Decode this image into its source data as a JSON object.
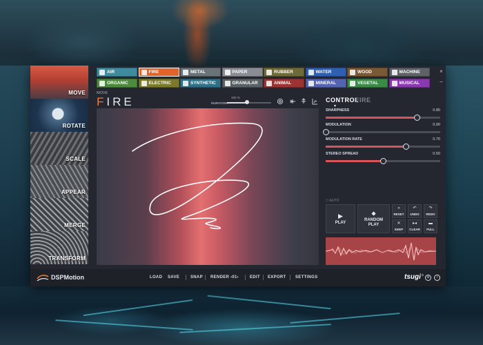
{
  "sidebar": {
    "items": [
      {
        "label": "MOVE"
      },
      {
        "label": "ROTATE"
      },
      {
        "label": "SCALE"
      },
      {
        "label": "APPEAR"
      },
      {
        "label": "MERGE"
      },
      {
        "label": "TRANSFORM"
      }
    ],
    "active": "MOVE"
  },
  "categories": [
    {
      "label": "AIR",
      "color": "#3f8a9c"
    },
    {
      "label": "FIRE",
      "color": "#e0642a",
      "active": true
    },
    {
      "label": "METAL",
      "color": "#6a7478"
    },
    {
      "label": "PAPER",
      "color": "#8a8e94"
    },
    {
      "label": "RUBBER",
      "color": "#6f6a3a"
    },
    {
      "label": "WATER",
      "color": "#2f5fb0"
    },
    {
      "label": "WOOD",
      "color": "#7a5a36"
    },
    {
      "label": "MACHINE",
      "color": "#5e6266"
    },
    {
      "label": "ORGANIC",
      "color": "#4c8a3e"
    },
    {
      "label": "ELECTRIC",
      "color": "#7a7a2a"
    },
    {
      "label": "SYNTHETIC",
      "color": "#2f6f86"
    },
    {
      "label": "GRANULAR",
      "color": "#5a6166"
    },
    {
      "label": "ANIMAL",
      "color": "#9c3434"
    },
    {
      "label": "MINERAL",
      "color": "#5563b0"
    },
    {
      "label": "VEGETAL",
      "color": "#3b8a48"
    },
    {
      "label": "MUSICAL",
      "color": "#8a3ab0"
    }
  ],
  "window": {
    "close_icon": "×",
    "minimize_icon": "–"
  },
  "preset": {
    "category": "MOVE",
    "name_initial": "F",
    "name_rest": "IRE",
    "duration_label": "DURATION",
    "duration_value": "100 %",
    "duration_fraction": 0.45
  },
  "tools": [
    "target-icon",
    "split-icon",
    "arrows-icon",
    "chart-icon"
  ],
  "control": {
    "tab_control": "CONTROL",
    "tab_fire": "FIRE",
    "params": [
      {
        "label": "SHARPNESS",
        "value": "0.80",
        "fraction": 0.8
      },
      {
        "label": "MODULATION",
        "value": "0.00",
        "fraction": 0.0
      },
      {
        "label": "MODULATION RATE",
        "value": "0.70",
        "fraction": 0.7
      },
      {
        "label": "STEREO SPREAD",
        "value": "0.50",
        "fraction": 0.5
      }
    ],
    "auto_label": "AUTO"
  },
  "transport": {
    "play": "PLAY",
    "random_play_1": "RANDOM",
    "random_play_2": "PLAY",
    "reset": "RESET",
    "undo": "UNDO",
    "redo": "REDO",
    "keep": "KEEP",
    "clear": "CLEAR",
    "full": "FULL"
  },
  "footer": {
    "logo": "DSPMotion",
    "load": "LOAD",
    "save": "SAVE",
    "snap": "SNAP",
    "render": "RENDER ‹01›",
    "edit": "EDIT",
    "export": "EXPORT",
    "settings": "SETTINGS",
    "brand": "tsugi",
    "brand_dot": "°"
  },
  "colors": {
    "accent": "#f07a33",
    "slider_fill": "#d9555a",
    "waveform_bg": "#a74448"
  }
}
